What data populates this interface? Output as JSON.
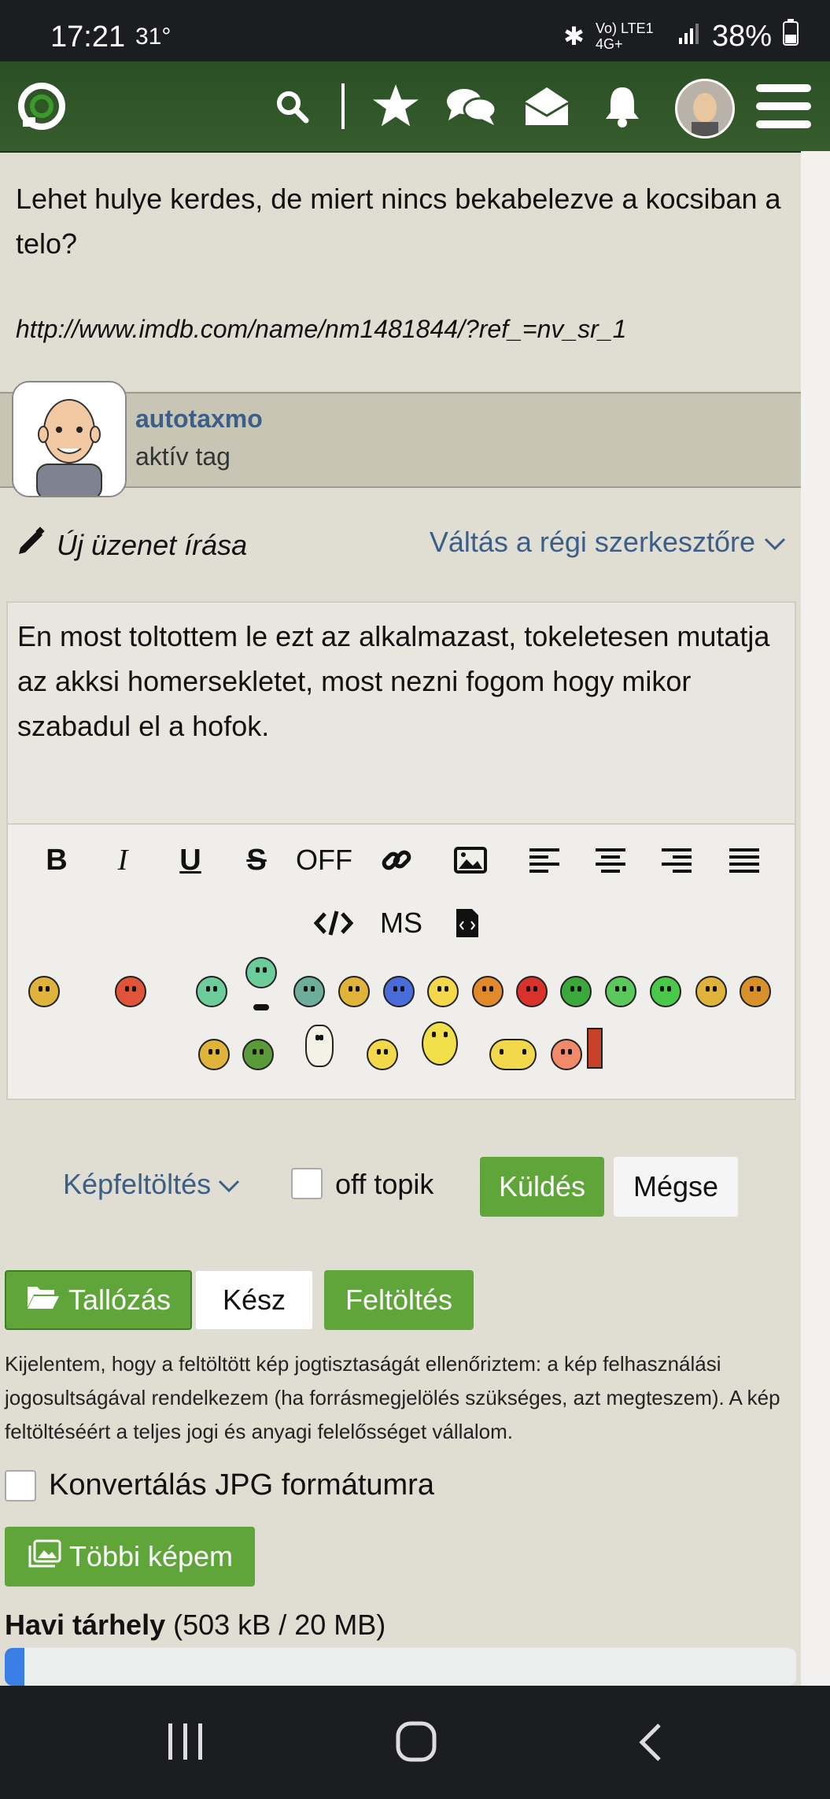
{
  "status_bar": {
    "time": "17:21",
    "temperature": "31°",
    "network": "Vo) LTE1 4G+",
    "battery": "38%"
  },
  "header": {
    "icons": [
      "logo-icon",
      "search-icon",
      "star-icon",
      "chat-icon",
      "envelope-icon",
      "bell-icon",
      "avatar",
      "menu-icon"
    ]
  },
  "post": {
    "text": "Lehet hulye kerdes, de miert nincs bekabelezve a kocsiban a telo?",
    "link": "http://www.imdb.com/name/nm1481844/?ref_=nv_sr_1"
  },
  "user": {
    "name": "autotaxmo",
    "rank": "aktív tag"
  },
  "compose": {
    "title": "Új üzenet írása",
    "switch_editor": "Váltás a régi szerkesztőre",
    "body": "En most toltottem le ezt az alkalmazast, tokeletesen mutatja az akksi homersekletet, most nezni fogom hogy mikor szabadul el a hofok.",
    "toolbar": {
      "bold": "B",
      "italic": "I",
      "underline": "U",
      "strike": "S",
      "off": "OFF",
      "ms": "MS"
    },
    "image_upload": "Képfeltöltés",
    "off_topic": "off topik",
    "send": "Küldés",
    "cancel": "Mégse"
  },
  "upload": {
    "browse": "Tallózás",
    "status": "Kész",
    "upload": "Feltöltés",
    "disclaimer": "Kijelentem, hogy a feltöltött kép jogtisztaságát ellenőriztem: a kép felhasználási jogosultságával rendelkezem (ha forrásmegjelölés szükséges, azt megteszem). A kép feltöltéséért a teljes jogi és anyagi felelősséget vállalom.",
    "convert_jpg": "Konvertálás JPG formátumra",
    "more_images": "Többi képem",
    "quota_label": "Havi tárhely",
    "quota_value": "(503 kB / 20 MB)",
    "quota_fraction": 0.025
  },
  "colors": {
    "header_green": "#2f5529",
    "link_blue": "#3b5f86",
    "button_green": "#5fa53a",
    "quota_blue": "#3a7ee6"
  }
}
